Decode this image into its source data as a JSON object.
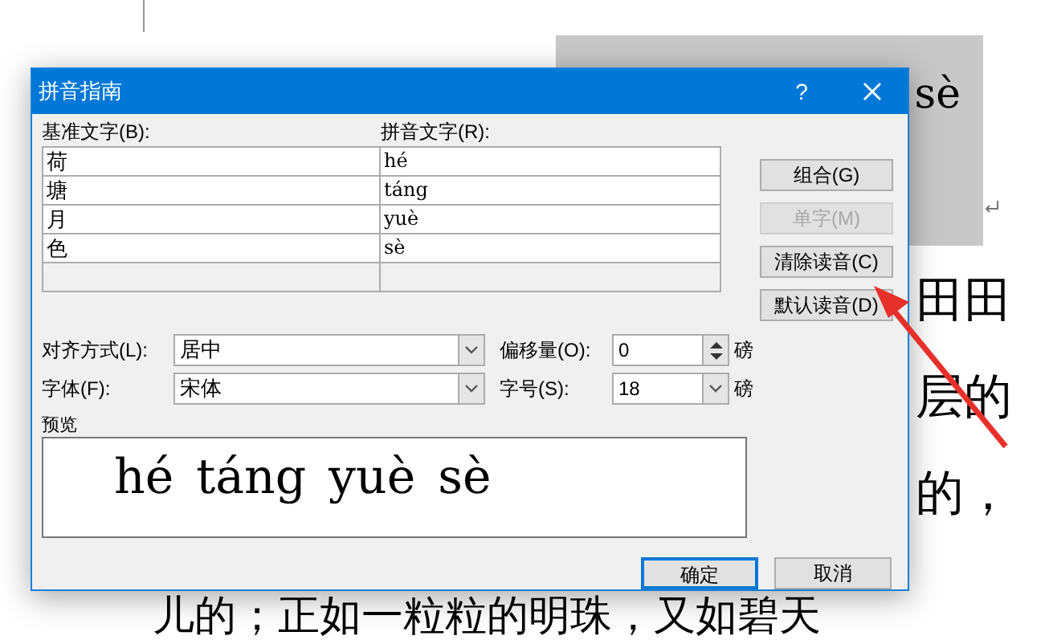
{
  "document": {
    "highlight_ruby": "sè",
    "lines": [
      "田田",
      "层的",
      "的，"
    ],
    "bottom_line": "儿的；正如一粒粒的明珠，又如碧天"
  },
  "dialog": {
    "title": "拼音指南",
    "help": "?",
    "base_label": "基准文字(B):",
    "ruby_label": "拼音文字(R):",
    "rows": [
      {
        "base": "荷",
        "ruby": "hé"
      },
      {
        "base": "塘",
        "ruby": "táng"
      },
      {
        "base": "月",
        "ruby": "yuè"
      },
      {
        "base": "色",
        "ruby": "sè"
      }
    ],
    "side_buttons": [
      {
        "label": "组合(G)",
        "disabled": false
      },
      {
        "label": "单字(M)",
        "disabled": true
      },
      {
        "label": "清除读音(C)",
        "disabled": false
      },
      {
        "label": "默认读音(D)",
        "disabled": false
      }
    ],
    "alignment": {
      "label": "对齐方式(L):",
      "value": "居中"
    },
    "offset": {
      "label": "偏移量(O):",
      "value": "0",
      "unit": "磅"
    },
    "font": {
      "label": "字体(F):",
      "value": "宋体"
    },
    "size": {
      "label": "字号(S):",
      "value": "18",
      "unit": "磅"
    },
    "preview": {
      "label": "预览",
      "items": [
        {
          "ruby": "hé"
        },
        {
          "ruby": "táng"
        },
        {
          "ruby": "yuè"
        },
        {
          "ruby": "sè"
        }
      ]
    },
    "footer_buttons": [
      {
        "label": "确定",
        "default": true
      },
      {
        "label": "取消",
        "default": false
      }
    ]
  }
}
